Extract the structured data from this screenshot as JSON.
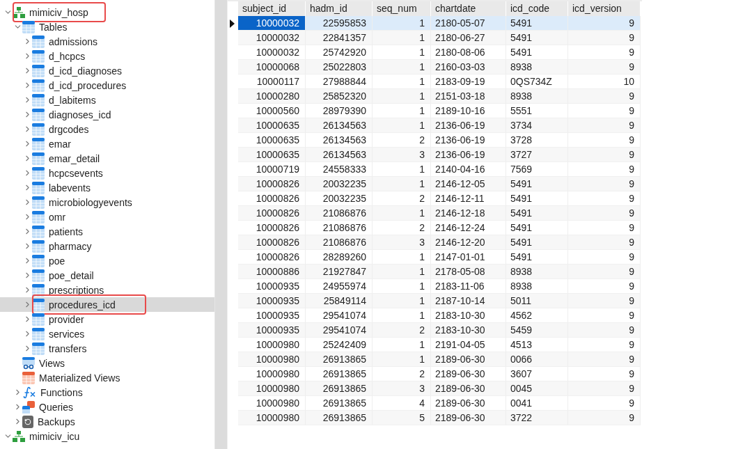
{
  "tree": [
    {
      "label": "mimiciv_hosp",
      "kind": "database",
      "expanded": true,
      "selected": false,
      "highlighted": true,
      "children": [
        {
          "label": "Tables",
          "kind": "tables",
          "expanded": true,
          "selected": false,
          "highlighted": false,
          "children": [
            {
              "label": "admissions",
              "kind": "table",
              "expanded": false,
              "selected": false,
              "highlighted": false
            },
            {
              "label": "d_hcpcs",
              "kind": "table",
              "expanded": false,
              "selected": false,
              "highlighted": false
            },
            {
              "label": "d_icd_diagnoses",
              "kind": "table",
              "expanded": false,
              "selected": false,
              "highlighted": false
            },
            {
              "label": "d_icd_procedures",
              "kind": "table",
              "expanded": false,
              "selected": false,
              "highlighted": false
            },
            {
              "label": "d_labitems",
              "kind": "table",
              "expanded": false,
              "selected": false,
              "highlighted": false
            },
            {
              "label": "diagnoses_icd",
              "kind": "table",
              "expanded": false,
              "selected": false,
              "highlighted": false
            },
            {
              "label": "drgcodes",
              "kind": "table",
              "expanded": false,
              "selected": false,
              "highlighted": false
            },
            {
              "label": "emar",
              "kind": "table",
              "expanded": false,
              "selected": false,
              "highlighted": false
            },
            {
              "label": "emar_detail",
              "kind": "table",
              "expanded": false,
              "selected": false,
              "highlighted": false
            },
            {
              "label": "hcpcsevents",
              "kind": "table",
              "expanded": false,
              "selected": false,
              "highlighted": false
            },
            {
              "label": "labevents",
              "kind": "table",
              "expanded": false,
              "selected": false,
              "highlighted": false
            },
            {
              "label": "microbiologyevents",
              "kind": "table",
              "expanded": false,
              "selected": false,
              "highlighted": false
            },
            {
              "label": "omr",
              "kind": "table",
              "expanded": false,
              "selected": false,
              "highlighted": false
            },
            {
              "label": "patients",
              "kind": "table",
              "expanded": false,
              "selected": false,
              "highlighted": false
            },
            {
              "label": "pharmacy",
              "kind": "table",
              "expanded": false,
              "selected": false,
              "highlighted": false
            },
            {
              "label": "poe",
              "kind": "table",
              "expanded": false,
              "selected": false,
              "highlighted": false
            },
            {
              "label": "poe_detail",
              "kind": "table",
              "expanded": false,
              "selected": false,
              "highlighted": false
            },
            {
              "label": "prescriptions",
              "kind": "table",
              "expanded": false,
              "selected": false,
              "highlighted": false
            },
            {
              "label": "procedures_icd",
              "kind": "table",
              "expanded": false,
              "selected": true,
              "highlighted": true
            },
            {
              "label": "provider",
              "kind": "table",
              "expanded": false,
              "selected": false,
              "highlighted": false
            },
            {
              "label": "services",
              "kind": "table",
              "expanded": false,
              "selected": false,
              "highlighted": false
            },
            {
              "label": "transfers",
              "kind": "table",
              "expanded": false,
              "selected": false,
              "highlighted": false
            }
          ]
        },
        {
          "label": "Views",
          "kind": "views",
          "selected": false,
          "highlighted": false
        },
        {
          "label": "Materialized Views",
          "kind": "matviews",
          "selected": false,
          "highlighted": false
        },
        {
          "label": "Functions",
          "kind": "functions",
          "expanded": false,
          "selected": false,
          "highlighted": false
        },
        {
          "label": "Queries",
          "kind": "queries",
          "expanded": false,
          "selected": false,
          "highlighted": false
        },
        {
          "label": "Backups",
          "kind": "backups",
          "expanded": false,
          "selected": false,
          "highlighted": false
        }
      ]
    },
    {
      "label": "mimiciv_icu",
      "kind": "database",
      "expanded": true,
      "selected": false,
      "highlighted": false
    }
  ],
  "table": {
    "columns": [
      {
        "label": "subject_id"
      },
      {
        "label": "hadm_id"
      },
      {
        "label": "seq_num"
      },
      {
        "label": "chartdate"
      },
      {
        "label": "icd_code"
      },
      {
        "label": "icd_version"
      }
    ],
    "rows": [
      {
        "selected": true,
        "cells": [
          "10000032",
          "22595853",
          "1",
          "2180-05-07",
          "5491",
          "9"
        ]
      },
      {
        "selected": false,
        "cells": [
          "10000032",
          "22841357",
          "1",
          "2180-06-27",
          "5491",
          "9"
        ]
      },
      {
        "selected": false,
        "cells": [
          "10000032",
          "25742920",
          "1",
          "2180-08-06",
          "5491",
          "9"
        ]
      },
      {
        "selected": false,
        "cells": [
          "10000068",
          "25022803",
          "1",
          "2160-03-03",
          "8938",
          "9"
        ]
      },
      {
        "selected": false,
        "cells": [
          "10000117",
          "27988844",
          "1",
          "2183-09-19",
          "0QS734Z",
          "10"
        ]
      },
      {
        "selected": false,
        "cells": [
          "10000280",
          "25852320",
          "1",
          "2151-03-18",
          "8938",
          "9"
        ]
      },
      {
        "selected": false,
        "cells": [
          "10000560",
          "28979390",
          "1",
          "2189-10-16",
          "5551",
          "9"
        ]
      },
      {
        "selected": false,
        "cells": [
          "10000635",
          "26134563",
          "1",
          "2136-06-19",
          "3734",
          "9"
        ]
      },
      {
        "selected": false,
        "cells": [
          "10000635",
          "26134563",
          "2",
          "2136-06-19",
          "3728",
          "9"
        ]
      },
      {
        "selected": false,
        "cells": [
          "10000635",
          "26134563",
          "3",
          "2136-06-19",
          "3727",
          "9"
        ]
      },
      {
        "selected": false,
        "cells": [
          "10000719",
          "24558333",
          "1",
          "2140-04-16",
          "7569",
          "9"
        ]
      },
      {
        "selected": false,
        "cells": [
          "10000826",
          "20032235",
          "1",
          "2146-12-05",
          "5491",
          "9"
        ]
      },
      {
        "selected": false,
        "cells": [
          "10000826",
          "20032235",
          "2",
          "2146-12-11",
          "5491",
          "9"
        ]
      },
      {
        "selected": false,
        "cells": [
          "10000826",
          "21086876",
          "1",
          "2146-12-18",
          "5491",
          "9"
        ]
      },
      {
        "selected": false,
        "cells": [
          "10000826",
          "21086876",
          "2",
          "2146-12-24",
          "5491",
          "9"
        ]
      },
      {
        "selected": false,
        "cells": [
          "10000826",
          "21086876",
          "3",
          "2146-12-20",
          "5491",
          "9"
        ]
      },
      {
        "selected": false,
        "cells": [
          "10000826",
          "28289260",
          "1",
          "2147-01-01",
          "5491",
          "9"
        ]
      },
      {
        "selected": false,
        "cells": [
          "10000886",
          "21927847",
          "1",
          "2178-05-08",
          "8938",
          "9"
        ]
      },
      {
        "selected": false,
        "cells": [
          "10000935",
          "24955974",
          "1",
          "2183-11-06",
          "8938",
          "9"
        ]
      },
      {
        "selected": false,
        "cells": [
          "10000935",
          "25849114",
          "1",
          "2187-10-14",
          "5011",
          "9"
        ]
      },
      {
        "selected": false,
        "cells": [
          "10000935",
          "29541074",
          "1",
          "2183-10-30",
          "4562",
          "9"
        ]
      },
      {
        "selected": false,
        "cells": [
          "10000935",
          "29541074",
          "2",
          "2183-10-30",
          "5459",
          "9"
        ]
      },
      {
        "selected": false,
        "cells": [
          "10000980",
          "25242409",
          "1",
          "2191-04-05",
          "4513",
          "9"
        ]
      },
      {
        "selected": false,
        "cells": [
          "10000980",
          "26913865",
          "1",
          "2189-06-30",
          "0066",
          "9"
        ]
      },
      {
        "selected": false,
        "cells": [
          "10000980",
          "26913865",
          "2",
          "2189-06-30",
          "3607",
          "9"
        ]
      },
      {
        "selected": false,
        "cells": [
          "10000980",
          "26913865",
          "3",
          "2189-06-30",
          "0045",
          "9"
        ]
      },
      {
        "selected": false,
        "cells": [
          "10000980",
          "26913865",
          "4",
          "2189-06-30",
          "0041",
          "9"
        ]
      },
      {
        "selected": false,
        "cells": [
          "10000980",
          "26913865",
          "5",
          "2189-06-30",
          "3722",
          "9"
        ]
      }
    ]
  }
}
